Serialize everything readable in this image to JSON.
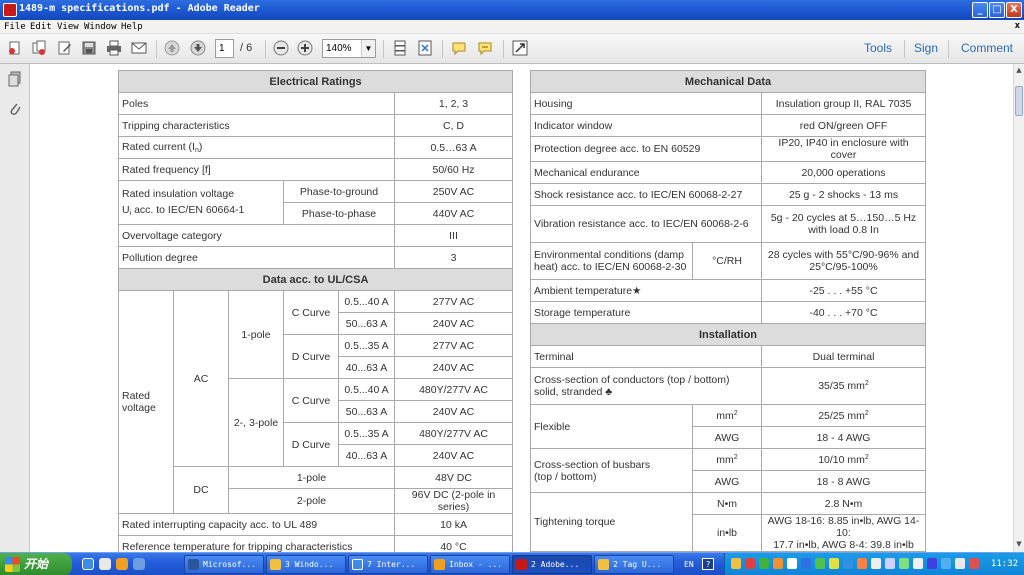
{
  "window": {
    "title": "1489-m specifications.pdf - Adobe Reader",
    "min": "_",
    "max": "□",
    "close": "X"
  },
  "menu": [
    "File",
    "Edit",
    "View",
    "Window",
    "Help"
  ],
  "menu_close": "x",
  "toolbar": {
    "page_current": "1",
    "page_total": "/ 6",
    "zoom": "140%",
    "tools": "Tools",
    "sign": "Sign",
    "comment": "Comment"
  },
  "electrical": {
    "header": "Electrical Ratings",
    "rows": [
      {
        "label": "Poles",
        "value": "1, 2, 3"
      },
      {
        "label": "Tripping characteristics",
        "value": "C, D"
      },
      {
        "label": "Rated current (I",
        "sub": "n",
        "after": ")",
        "value": "0.5…63 A"
      },
      {
        "label": "Rated frequency [f]",
        "value": "50/60 Hz"
      }
    ],
    "insulation_label_1": "Rated insulation voltage",
    "insulation_label_2a": "U",
    "insulation_label_2sub": "i",
    "insulation_label_2b": " acc. to IEC/EN 60664-1",
    "phase_ground": "Phase-to-ground",
    "phase_ground_value": "250V AC",
    "phase_phase": "Phase-to-phase",
    "phase_phase_value": "440V AC",
    "overvoltage": "Overvoltage category",
    "overvoltage_value": "III",
    "pollution": "Pollution degree",
    "pollution_value": "3"
  },
  "ul": {
    "header": "Data acc. to UL/CSA",
    "rated_voltage_1": "Rated",
    "rated_voltage_2": "voltage",
    "ac": "AC",
    "dc": "DC",
    "pole1": "1-pole",
    "pole23": "2-, 3-pole",
    "c_curve": "C Curve",
    "d_curve": "D Curve",
    "ac_rows": [
      {
        "range": "0.5...40 A",
        "value": "277V AC"
      },
      {
        "range": "50...63 A",
        "value": "240V AC"
      },
      {
        "range": "0.5...35 A",
        "value": "277V AC"
      },
      {
        "range": "40...63 A",
        "value": "240V AC"
      },
      {
        "range": "0.5...40 A",
        "value": "480Y/277V AC"
      },
      {
        "range": "50...63 A",
        "value": "240V AC"
      },
      {
        "range": "0.5...35 A",
        "value": "480Y/277V AC"
      },
      {
        "range": "40...63 A",
        "value": "240V AC"
      }
    ],
    "dc_1pole": "1-pole",
    "dc_1pole_value": "48V DC",
    "dc_2pole": "2-pole",
    "dc_2pole_value": "96V DC (2-pole in series)",
    "interrupting": "Rated interrupting capacity acc. to UL 489",
    "interrupting_value": "10 kA",
    "ref_temp": "Reference temperature for tripping characteristics",
    "ref_temp_value": "40 °C"
  },
  "mechanical": {
    "header": "Mechanical Data",
    "rows": [
      {
        "label": "Housing",
        "value": "Insulation group II, RAL 7035"
      },
      {
        "label": "Indicator window",
        "value": "red ON/green OFF"
      },
      {
        "label": "Protection degree acc. to EN 60529",
        "value": "IP20, IP40 in enclosure with cover"
      },
      {
        "label": "Mechanical endurance",
        "value": "20,000 operations"
      },
      {
        "label": "Shock resistance acc. to IEC/EN 60068-2-27",
        "value": "25 g - 2 shocks - 13 ms"
      }
    ],
    "vibration": "Vibration resistance acc. to IEC/EN 60068-2-6",
    "vibration_value_1": "5g - 20 cycles at 5…150…5 Hz",
    "vibration_value_2": "with load 0.8 In",
    "env_1": "Environmental conditions (damp",
    "env_2": "heat) acc. to IEC/EN 60068-2-30",
    "env_unit": "°C/RH",
    "env_value_1": "28 cycles with 55°C/90-96% and",
    "env_value_2": "25°C/95-100%",
    "ambient": "Ambient temperature★",
    "ambient_value": "-25 . . . +55 °C",
    "storage": "Storage temperature",
    "storage_value": "-40 . . . +70 °C"
  },
  "installation": {
    "header": "Installation",
    "terminal": "Terminal",
    "terminal_value": "Dual terminal",
    "cross_1": "Cross-section of conductors (top / bottom)",
    "cross_2": "solid, stranded ♣",
    "cross_value": "35/35 mm",
    "cross_sup": "2",
    "flexible": "Flexible",
    "flex_mm": "mm",
    "flex_mm_sup": "2",
    "flex_mm_value": "25/25 mm",
    "flex_awg": "AWG",
    "flex_awg_value": "18 - 4 AWG",
    "busbar_1": "Cross-section of busbars",
    "busbar_2": "(top / bottom)",
    "bus_mm": "mm",
    "bus_mm_value": "10/10 mm",
    "bus_awg": "AWG",
    "bus_awg_value": "18 - 8 AWG",
    "torque": "Tightening torque",
    "torque_nm": "N•m",
    "torque_nm_value": "2.8 N•m",
    "torque_inlb": "in•lb",
    "torque_inlb_value_1": "AWG 18-16: 8.85 in•lb, AWG 14-10:",
    "torque_inlb_value_2": "17.7 in•lb, AWG 8-4: 39.8 in•lb"
  },
  "taskbar": {
    "start": "开始",
    "buttons": [
      "Microsof...",
      "3 Windo...",
      "7 Inter...",
      "Inbox - ...",
      "2 Adobe...",
      "2 Tag U..."
    ],
    "lang": "EN",
    "help": "?",
    "clock": "11:32"
  }
}
